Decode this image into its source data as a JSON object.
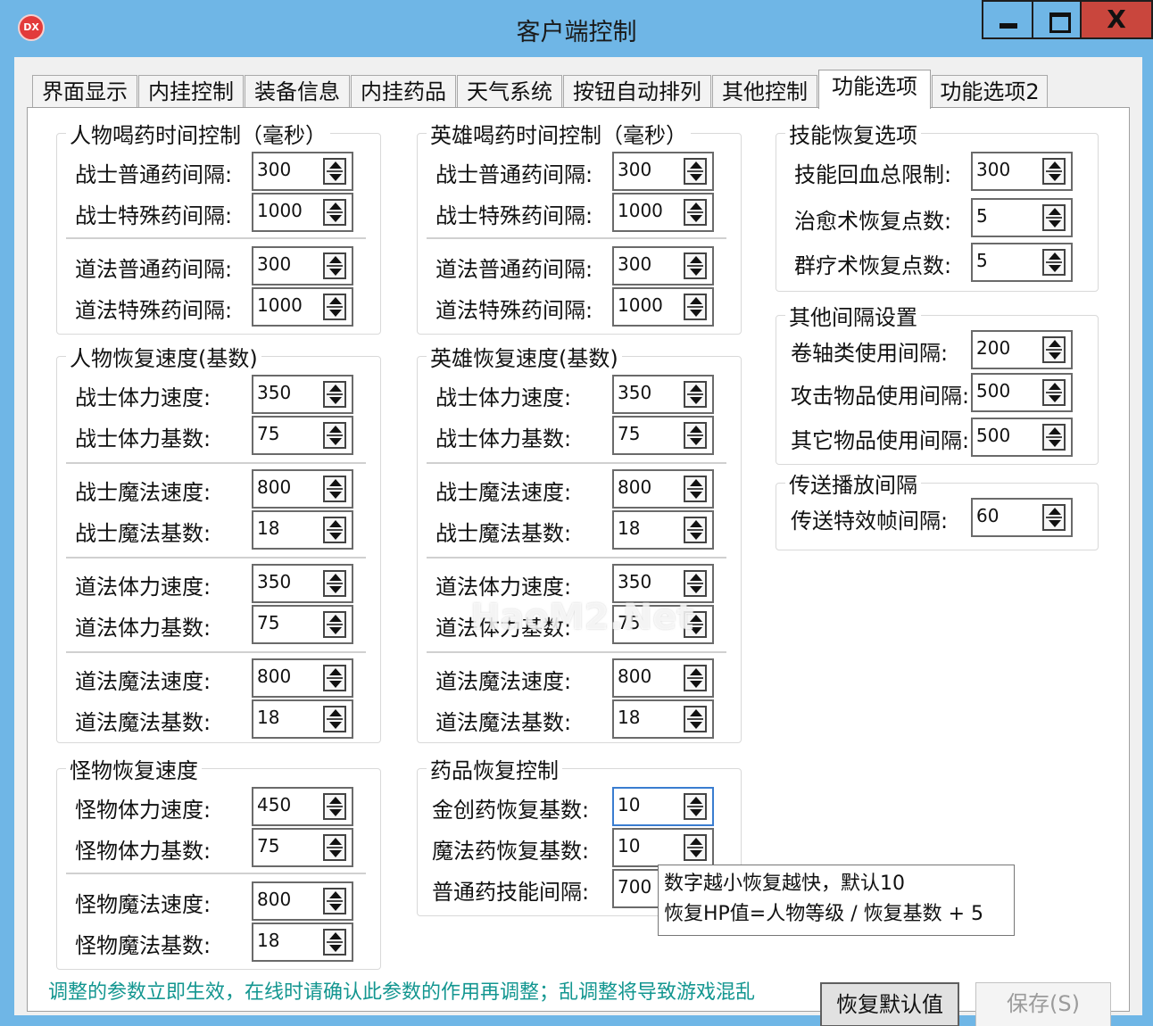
{
  "window": {
    "title": "客户端控制",
    "icon_text": "DX",
    "close_symbol": "X"
  },
  "tabs": [
    {
      "label": "界面显示",
      "active": false
    },
    {
      "label": "内挂控制",
      "active": false
    },
    {
      "label": "装备信息",
      "active": false
    },
    {
      "label": "内挂药品",
      "active": false
    },
    {
      "label": "天气系统",
      "active": false
    },
    {
      "label": "按钮自动排列",
      "active": false
    },
    {
      "label": "其他控制",
      "active": false
    },
    {
      "label": "功能选项",
      "active": true
    },
    {
      "label": "功能选项2",
      "active": false
    }
  ],
  "groups": {
    "player_potion": {
      "title": "人物喝药时间控制（毫秒）",
      "rows": [
        {
          "label": "战士普通药间隔:",
          "value": "300"
        },
        {
          "label": "战士特殊药间隔:",
          "value": "1000"
        },
        {
          "label": "道法普通药间隔:",
          "value": "300"
        },
        {
          "label": "道法特殊药间隔:",
          "value": "1000"
        }
      ]
    },
    "hero_potion": {
      "title": "英雄喝药时间控制（毫秒）",
      "rows": [
        {
          "label": "战士普通药间隔:",
          "value": "300"
        },
        {
          "label": "战士特殊药间隔:",
          "value": "1000"
        },
        {
          "label": "道法普通药间隔:",
          "value": "300"
        },
        {
          "label": "道法特殊药间隔:",
          "value": "1000"
        }
      ]
    },
    "skill_recovery": {
      "title": "技能恢复选项",
      "rows": [
        {
          "label": "技能回血总限制:",
          "value": "300"
        },
        {
          "label": "治愈术恢复点数:",
          "value": "5"
        },
        {
          "label": "群疗术恢复点数:",
          "value": "5"
        }
      ]
    },
    "other_interval": {
      "title": "其他间隔设置",
      "rows": [
        {
          "label": "卷轴类使用间隔:",
          "value": "200"
        },
        {
          "label": "攻击物品使用间隔:",
          "value": "500"
        },
        {
          "label": "其它物品使用间隔:",
          "value": "500"
        }
      ]
    },
    "teleport": {
      "title": "传送播放间隔",
      "rows": [
        {
          "label": "传送特效帧间隔:",
          "value": "60"
        }
      ]
    },
    "player_recovery": {
      "title": "人物恢复速度(基数)",
      "rows": [
        {
          "label": "战士体力速度:",
          "value": "350"
        },
        {
          "label": "战士体力基数:",
          "value": "75"
        },
        {
          "label": "战士魔法速度:",
          "value": "800"
        },
        {
          "label": "战士魔法基数:",
          "value": "18"
        },
        {
          "label": "道法体力速度:",
          "value": "350"
        },
        {
          "label": "道法体力基数:",
          "value": "75"
        },
        {
          "label": "道法魔法速度:",
          "value": "800"
        },
        {
          "label": "道法魔法基数:",
          "value": "18"
        }
      ]
    },
    "hero_recovery": {
      "title": "英雄恢复速度(基数)",
      "rows": [
        {
          "label": "战士体力速度:",
          "value": "350"
        },
        {
          "label": "战士体力基数:",
          "value": "75"
        },
        {
          "label": "战士魔法速度:",
          "value": "800"
        },
        {
          "label": "战士魔法基数:",
          "value": "18"
        },
        {
          "label": "道法体力速度:",
          "value": "350"
        },
        {
          "label": "道法体力基数:",
          "value": "75"
        },
        {
          "label": "道法魔法速度:",
          "value": "800"
        },
        {
          "label": "道法魔法基数:",
          "value": "18"
        }
      ]
    },
    "monster_recovery": {
      "title": "怪物恢复速度",
      "rows": [
        {
          "label": "怪物体力速度:",
          "value": "450"
        },
        {
          "label": "怪物体力基数:",
          "value": "75"
        },
        {
          "label": "怪物魔法速度:",
          "value": "800"
        },
        {
          "label": "怪物魔法基数:",
          "value": "18"
        }
      ]
    },
    "potion_recovery": {
      "title": "药品恢复控制",
      "rows": [
        {
          "label": "金创药恢复基数:",
          "value": "10"
        },
        {
          "label": "魔法药恢复基数:",
          "value": "10"
        },
        {
          "label": "普通药技能间隔:",
          "value": "700"
        }
      ]
    }
  },
  "tooltip": {
    "line1": "数字越小恢复越快，默认10",
    "line2": "恢复HP值=人物等级 / 恢复基数 + 5"
  },
  "buttons": {
    "restore_default": "恢复默认值",
    "save": "保存(S)"
  },
  "notice": "调整的参数立即生效，在线时请确认此参数的作用再调整；乱调整将导致游戏混乱",
  "watermark": "HaoM2.Net"
}
